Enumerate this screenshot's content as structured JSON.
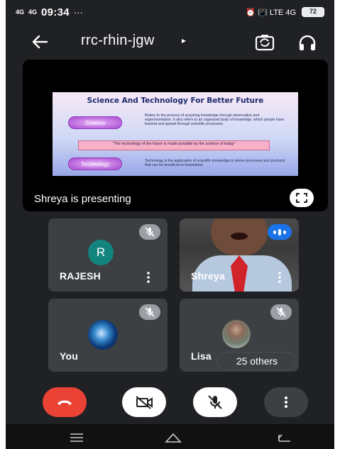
{
  "status_bar": {
    "network_left": "4G",
    "network_right": "4G",
    "time": "09:34",
    "extra": "···",
    "right_icons": "⏰ 📳 LTE 4G",
    "battery": "72"
  },
  "top_bar": {
    "meeting_code": "rrc-rhin-jgw",
    "code_arrow": "▸"
  },
  "presentation": {
    "slide_title": "Science And Technology For Better Future",
    "pill_science": "Science",
    "pill_technology": "Technology",
    "science_text": "Refers to the process of acquiring knowledge through observation and experimentation. It also refers to an organized body of knowledge, which people have learned and gained through scientific processes.",
    "quote_text": "\"The technology of the future is made possible by the science of today\"",
    "technology_text": "Technology is the application of scientific knowledge to derive processes and products that can be beneficial to humankind",
    "presenting_label": "Shreya is presenting"
  },
  "participants": [
    {
      "name": "RAJESH",
      "initial": "R",
      "muted": true
    },
    {
      "name": "Shreya",
      "muted": false,
      "speaking": true
    },
    {
      "name": "You",
      "muted": true
    },
    {
      "name": "Lisa",
      "muted": true
    }
  ],
  "others_badge": "25 others",
  "colors": {
    "end_call": "#ea4335",
    "avatar_r": "#12857e",
    "speaking": "#1a73e8",
    "background": "#202124",
    "tile": "#3c4043"
  },
  "icons": {
    "back": "arrow-left-icon",
    "switch_camera": "switch-camera-icon",
    "audio": "headphones-icon",
    "fullscreen": "fullscreen-icon",
    "mic_off": "mic-off-icon",
    "more": "more-vertical-icon",
    "end_call": "phone-hangup-icon",
    "camera_off": "camera-off-icon"
  }
}
